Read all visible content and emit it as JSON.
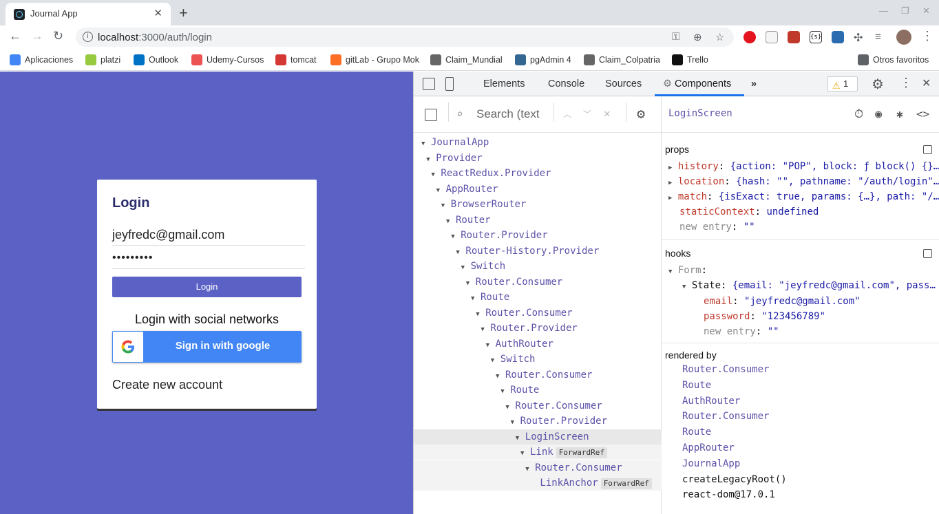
{
  "browser": {
    "tab_title": "Journal App",
    "url_host": "localhost",
    "url_path": ":3000/auth/login",
    "bookmarks": [
      {
        "label": "Aplicaciones",
        "color": "#4285f4"
      },
      {
        "label": "platzi",
        "color": "#98ca3f"
      },
      {
        "label": "Outlook",
        "color": "#0072c6"
      },
      {
        "label": "Udemy-Cursos",
        "color": "#ec5252"
      },
      {
        "label": "tomcat",
        "color": "#d33833"
      },
      {
        "label": "gitLab - Grupo Mok",
        "color": "#fc6d26"
      },
      {
        "label": "Claim_Mundial",
        "color": "#666666"
      },
      {
        "label": "pgAdmin 4",
        "color": "#336791"
      },
      {
        "label": "Claim_Colpatria",
        "color": "#666666"
      },
      {
        "label": "Trello",
        "color": "#111111"
      }
    ],
    "other_bookmarks": "Otros favoritos"
  },
  "login": {
    "title": "Login",
    "email": "jeyfredc@gmail.com",
    "password_mask": "•••••••••",
    "login_button": "Login",
    "social_label": "Login with social networks",
    "google_button": "Sign in with google",
    "create_account": "Create new account",
    "bg_color": "#5c62c5"
  },
  "devtools": {
    "tabs": [
      "Elements",
      "Console",
      "Sources",
      "Components"
    ],
    "warning_count": "1",
    "search_placeholder": "Search (text",
    "tree": [
      {
        "label": "JournalApp",
        "depth": 0,
        "arrow": true
      },
      {
        "label": "Provider",
        "depth": 1,
        "arrow": true
      },
      {
        "label": "ReactRedux.Provider",
        "depth": 2,
        "arrow": true
      },
      {
        "label": "AppRouter",
        "depth": 3,
        "arrow": true
      },
      {
        "label": "BrowserRouter",
        "depth": 4,
        "arrow": true
      },
      {
        "label": "Router",
        "depth": 5,
        "arrow": true
      },
      {
        "label": "Router.Provider",
        "depth": 6,
        "arrow": true
      },
      {
        "label": "Router-History.Provider",
        "depth": 7,
        "arrow": true
      },
      {
        "label": "Switch",
        "depth": 8,
        "arrow": true
      },
      {
        "label": "Router.Consumer",
        "depth": 9,
        "arrow": true
      },
      {
        "label": "Route",
        "depth": 10,
        "arrow": true
      },
      {
        "label": "Router.Consumer",
        "depth": 11,
        "arrow": true
      },
      {
        "label": "Router.Provider",
        "depth": 12,
        "arrow": true
      },
      {
        "label": "AuthRouter",
        "depth": 13,
        "arrow": true
      },
      {
        "label": "Switch",
        "depth": 14,
        "arrow": true
      },
      {
        "label": "Router.Consumer",
        "depth": 15,
        "arrow": true
      },
      {
        "label": "Route",
        "depth": 16,
        "arrow": true
      },
      {
        "label": "Router.Consumer",
        "depth": 17,
        "arrow": true
      },
      {
        "label": "Router.Provider",
        "depth": 18,
        "arrow": true
      },
      {
        "label": "LoginScreen",
        "depth": 19,
        "arrow": true,
        "selected": true
      },
      {
        "label": "Link",
        "depth": 20,
        "arrow": true,
        "badge": "ForwardRef",
        "sub": true
      },
      {
        "label": "Router.Consumer",
        "depth": 21,
        "arrow": true,
        "sub": true
      },
      {
        "label": "LinkAnchor",
        "depth": 22,
        "arrow": false,
        "badge": "ForwardRef",
        "sub": true
      }
    ],
    "selected_component": "LoginScreen",
    "props_title": "props",
    "props": [
      {
        "key": "history",
        "value": "{action: \"POP\", block: ƒ block() {}…",
        "expandable": true
      },
      {
        "key": "location",
        "value": "{hash: \"\", pathname: \"/auth/login\"…",
        "expandable": true
      },
      {
        "key": "match",
        "value": "{isExact: true, params: {…}, path: \"/…",
        "expandable": true
      },
      {
        "key": "staticContext",
        "value": "undefined",
        "expandable": false
      }
    ],
    "new_entry_label": "new entry",
    "new_entry_value": "\"\"",
    "hooks_title": "hooks",
    "hook_form": "Form",
    "hook_state_key": "State",
    "hook_state_value": "{email: \"jeyfredc@gmail.com\", pass…",
    "hook_email_key": "email",
    "hook_email_value": "\"jeyfredc@gmail.com\"",
    "hook_password_key": "password",
    "hook_password_value": "\"123456789\"",
    "rendered_by_title": "rendered by",
    "rendered_by": [
      {
        "label": "Router.Consumer",
        "plain": false
      },
      {
        "label": "Route",
        "plain": false
      },
      {
        "label": "AuthRouter",
        "plain": false
      },
      {
        "label": "Router.Consumer",
        "plain": false
      },
      {
        "label": "Route",
        "plain": false
      },
      {
        "label": "AppRouter",
        "plain": false
      },
      {
        "label": "JournalApp",
        "plain": false
      },
      {
        "label": "createLegacyRoot()",
        "plain": true
      },
      {
        "label": "react-dom@17.0.1",
        "plain": true
      }
    ]
  }
}
